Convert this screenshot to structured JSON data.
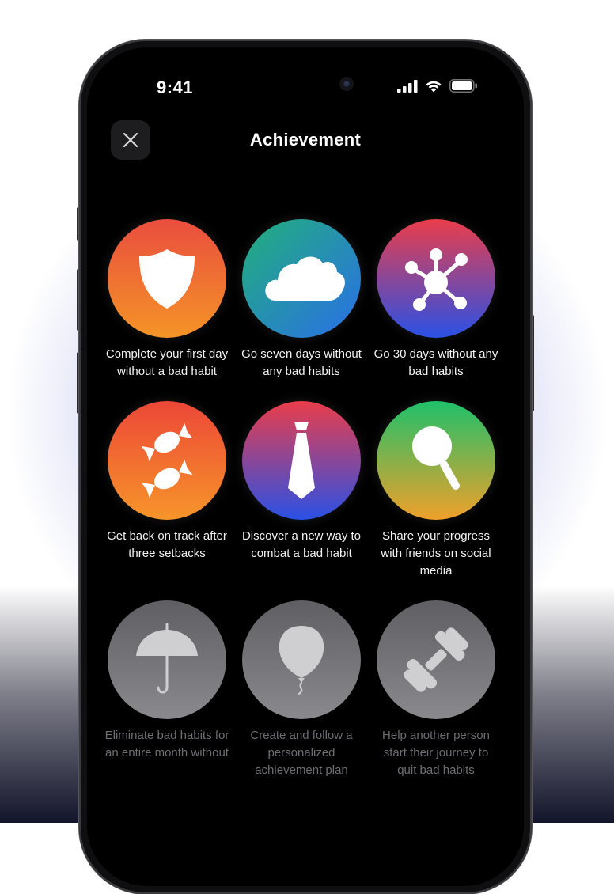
{
  "status_bar": {
    "time": "9:41"
  },
  "header": {
    "title": "Achievement",
    "close_icon": "close-icon"
  },
  "achievements": [
    {
      "label": "Complete your first day without a bad habit",
      "icon": "shield-icon",
      "unlocked": true,
      "colors": [
        "#e94d3e",
        "#f59427"
      ]
    },
    {
      "label": "Go seven days without any bad habits",
      "icon": "cloud-icon",
      "unlocked": true,
      "colors": [
        "#22b07a",
        "#2a6fe8"
      ]
    },
    {
      "label": "Go 30 days without any bad habits",
      "icon": "network-icon",
      "unlocked": true,
      "colors": [
        "#ea3d4a",
        "#2a51e6"
      ]
    },
    {
      "label": "Get back on track after three setbacks",
      "icon": "candy-icon",
      "unlocked": true,
      "colors": [
        "#ec4737",
        "#f7952a"
      ]
    },
    {
      "label": "Discover a new way to combat a bad habit",
      "icon": "tie-icon",
      "unlocked": true,
      "colors": [
        "#ea3d4a",
        "#2a51e6"
      ]
    },
    {
      "label": "Share your progress with friends on social media",
      "icon": "magnifier-icon",
      "unlocked": true,
      "colors": [
        "#1fc06a",
        "#f0a02a"
      ]
    },
    {
      "label": "Eliminate bad habits for an entire month without",
      "icon": "umbrella-icon",
      "unlocked": false,
      "colors": [
        "#5f5f63",
        "#8a8a8e"
      ]
    },
    {
      "label": "Create and follow a personalized achievement plan",
      "icon": "balloon-icon",
      "unlocked": false,
      "colors": [
        "#5f5f63",
        "#8a8a8e"
      ]
    },
    {
      "label": "Help another person start their journey to quit bad habits",
      "icon": "dumbbell-icon",
      "unlocked": false,
      "colors": [
        "#5f5f63",
        "#8a8a8e"
      ]
    }
  ]
}
